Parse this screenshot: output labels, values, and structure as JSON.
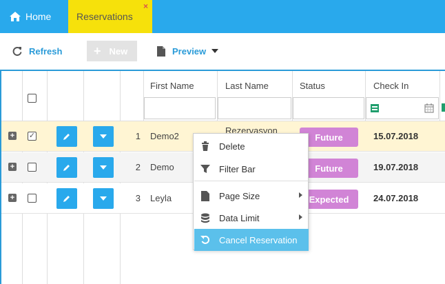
{
  "tabs": {
    "home_label": "Home",
    "reservations_label": "Reservations",
    "close_symbol": "×"
  },
  "toolbar": {
    "refresh_label": "Refresh",
    "new_label": "New",
    "preview_label": "Preview"
  },
  "grid": {
    "columns": [
      "First Name",
      "Last Name",
      "Status",
      "Check In"
    ],
    "rows": [
      {
        "num": "1",
        "first": "Demo2",
        "last": "Rezervasyon",
        "status": "Future",
        "check_in": "15.07.2018",
        "checked": true
      },
      {
        "num": "2",
        "first": "Demo",
        "last": "",
        "status": "Future",
        "check_in": "19.07.2018",
        "checked": false
      },
      {
        "num": "3",
        "first": "Leyla",
        "last": "",
        "status": "Expected",
        "check_in": "24.07.2018",
        "checked": false
      }
    ]
  },
  "context_menu": {
    "items": [
      "Delete",
      "Filter Bar",
      "Page Size",
      "Data Limit",
      "Cancel Reservation"
    ]
  },
  "colors": {
    "accent": "#29a9ec",
    "active_tab": "#f6e10b",
    "status_badge": "#d184d6",
    "selected_row": "#fff5d3",
    "menu_highlight": "#5bc0eb"
  }
}
